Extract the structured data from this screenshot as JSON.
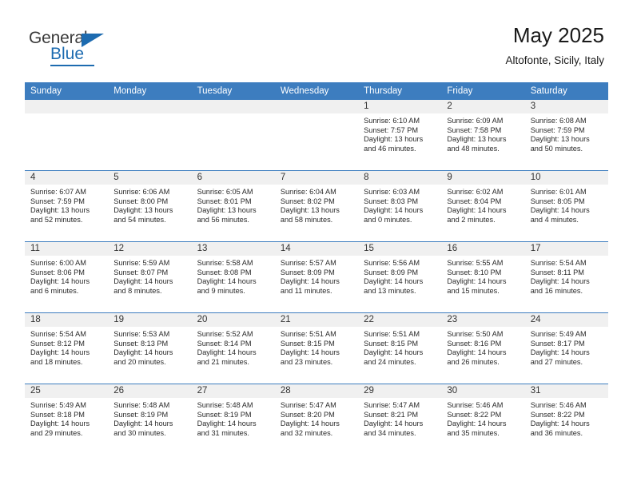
{
  "brand": {
    "name_top": "General",
    "name_bottom": "Blue",
    "accent_color": "#1d6bb0"
  },
  "header": {
    "title": "May 2025",
    "subtitle": "Altofonte, Sicily, Italy"
  },
  "calendar": {
    "header_color": "#3d7dbf",
    "day_names": [
      "Sunday",
      "Monday",
      "Tuesday",
      "Wednesday",
      "Thursday",
      "Friday",
      "Saturday"
    ],
    "weeks": [
      [
        {
          "empty": true
        },
        {
          "empty": true
        },
        {
          "empty": true
        },
        {
          "empty": true
        },
        {
          "day": "1",
          "sunrise": "Sunrise: 6:10 AM",
          "sunset": "Sunset: 7:57 PM",
          "daylight1": "Daylight: 13 hours",
          "daylight2": "and 46 minutes."
        },
        {
          "day": "2",
          "sunrise": "Sunrise: 6:09 AM",
          "sunset": "Sunset: 7:58 PM",
          "daylight1": "Daylight: 13 hours",
          "daylight2": "and 48 minutes."
        },
        {
          "day": "3",
          "sunrise": "Sunrise: 6:08 AM",
          "sunset": "Sunset: 7:59 PM",
          "daylight1": "Daylight: 13 hours",
          "daylight2": "and 50 minutes."
        }
      ],
      [
        {
          "day": "4",
          "sunrise": "Sunrise: 6:07 AM",
          "sunset": "Sunset: 7:59 PM",
          "daylight1": "Daylight: 13 hours",
          "daylight2": "and 52 minutes."
        },
        {
          "day": "5",
          "sunrise": "Sunrise: 6:06 AM",
          "sunset": "Sunset: 8:00 PM",
          "daylight1": "Daylight: 13 hours",
          "daylight2": "and 54 minutes."
        },
        {
          "day": "6",
          "sunrise": "Sunrise: 6:05 AM",
          "sunset": "Sunset: 8:01 PM",
          "daylight1": "Daylight: 13 hours",
          "daylight2": "and 56 minutes."
        },
        {
          "day": "7",
          "sunrise": "Sunrise: 6:04 AM",
          "sunset": "Sunset: 8:02 PM",
          "daylight1": "Daylight: 13 hours",
          "daylight2": "and 58 minutes."
        },
        {
          "day": "8",
          "sunrise": "Sunrise: 6:03 AM",
          "sunset": "Sunset: 8:03 PM",
          "daylight1": "Daylight: 14 hours",
          "daylight2": "and 0 minutes."
        },
        {
          "day": "9",
          "sunrise": "Sunrise: 6:02 AM",
          "sunset": "Sunset: 8:04 PM",
          "daylight1": "Daylight: 14 hours",
          "daylight2": "and 2 minutes."
        },
        {
          "day": "10",
          "sunrise": "Sunrise: 6:01 AM",
          "sunset": "Sunset: 8:05 PM",
          "daylight1": "Daylight: 14 hours",
          "daylight2": "and 4 minutes."
        }
      ],
      [
        {
          "day": "11",
          "sunrise": "Sunrise: 6:00 AM",
          "sunset": "Sunset: 8:06 PM",
          "daylight1": "Daylight: 14 hours",
          "daylight2": "and 6 minutes."
        },
        {
          "day": "12",
          "sunrise": "Sunrise: 5:59 AM",
          "sunset": "Sunset: 8:07 PM",
          "daylight1": "Daylight: 14 hours",
          "daylight2": "and 8 minutes."
        },
        {
          "day": "13",
          "sunrise": "Sunrise: 5:58 AM",
          "sunset": "Sunset: 8:08 PM",
          "daylight1": "Daylight: 14 hours",
          "daylight2": "and 9 minutes."
        },
        {
          "day": "14",
          "sunrise": "Sunrise: 5:57 AM",
          "sunset": "Sunset: 8:09 PM",
          "daylight1": "Daylight: 14 hours",
          "daylight2": "and 11 minutes."
        },
        {
          "day": "15",
          "sunrise": "Sunrise: 5:56 AM",
          "sunset": "Sunset: 8:09 PM",
          "daylight1": "Daylight: 14 hours",
          "daylight2": "and 13 minutes."
        },
        {
          "day": "16",
          "sunrise": "Sunrise: 5:55 AM",
          "sunset": "Sunset: 8:10 PM",
          "daylight1": "Daylight: 14 hours",
          "daylight2": "and 15 minutes."
        },
        {
          "day": "17",
          "sunrise": "Sunrise: 5:54 AM",
          "sunset": "Sunset: 8:11 PM",
          "daylight1": "Daylight: 14 hours",
          "daylight2": "and 16 minutes."
        }
      ],
      [
        {
          "day": "18",
          "sunrise": "Sunrise: 5:54 AM",
          "sunset": "Sunset: 8:12 PM",
          "daylight1": "Daylight: 14 hours",
          "daylight2": "and 18 minutes."
        },
        {
          "day": "19",
          "sunrise": "Sunrise: 5:53 AM",
          "sunset": "Sunset: 8:13 PM",
          "daylight1": "Daylight: 14 hours",
          "daylight2": "and 20 minutes."
        },
        {
          "day": "20",
          "sunrise": "Sunrise: 5:52 AM",
          "sunset": "Sunset: 8:14 PM",
          "daylight1": "Daylight: 14 hours",
          "daylight2": "and 21 minutes."
        },
        {
          "day": "21",
          "sunrise": "Sunrise: 5:51 AM",
          "sunset": "Sunset: 8:15 PM",
          "daylight1": "Daylight: 14 hours",
          "daylight2": "and 23 minutes."
        },
        {
          "day": "22",
          "sunrise": "Sunrise: 5:51 AM",
          "sunset": "Sunset: 8:15 PM",
          "daylight1": "Daylight: 14 hours",
          "daylight2": "and 24 minutes."
        },
        {
          "day": "23",
          "sunrise": "Sunrise: 5:50 AM",
          "sunset": "Sunset: 8:16 PM",
          "daylight1": "Daylight: 14 hours",
          "daylight2": "and 26 minutes."
        },
        {
          "day": "24",
          "sunrise": "Sunrise: 5:49 AM",
          "sunset": "Sunset: 8:17 PM",
          "daylight1": "Daylight: 14 hours",
          "daylight2": "and 27 minutes."
        }
      ],
      [
        {
          "day": "25",
          "sunrise": "Sunrise: 5:49 AM",
          "sunset": "Sunset: 8:18 PM",
          "daylight1": "Daylight: 14 hours",
          "daylight2": "and 29 minutes."
        },
        {
          "day": "26",
          "sunrise": "Sunrise: 5:48 AM",
          "sunset": "Sunset: 8:19 PM",
          "daylight1": "Daylight: 14 hours",
          "daylight2": "and 30 minutes."
        },
        {
          "day": "27",
          "sunrise": "Sunrise: 5:48 AM",
          "sunset": "Sunset: 8:19 PM",
          "daylight1": "Daylight: 14 hours",
          "daylight2": "and 31 minutes."
        },
        {
          "day": "28",
          "sunrise": "Sunrise: 5:47 AM",
          "sunset": "Sunset: 8:20 PM",
          "daylight1": "Daylight: 14 hours",
          "daylight2": "and 32 minutes."
        },
        {
          "day": "29",
          "sunrise": "Sunrise: 5:47 AM",
          "sunset": "Sunset: 8:21 PM",
          "daylight1": "Daylight: 14 hours",
          "daylight2": "and 34 minutes."
        },
        {
          "day": "30",
          "sunrise": "Sunrise: 5:46 AM",
          "sunset": "Sunset: 8:22 PM",
          "daylight1": "Daylight: 14 hours",
          "daylight2": "and 35 minutes."
        },
        {
          "day": "31",
          "sunrise": "Sunrise: 5:46 AM",
          "sunset": "Sunset: 8:22 PM",
          "daylight1": "Daylight: 14 hours",
          "daylight2": "and 36 minutes."
        }
      ]
    ]
  }
}
